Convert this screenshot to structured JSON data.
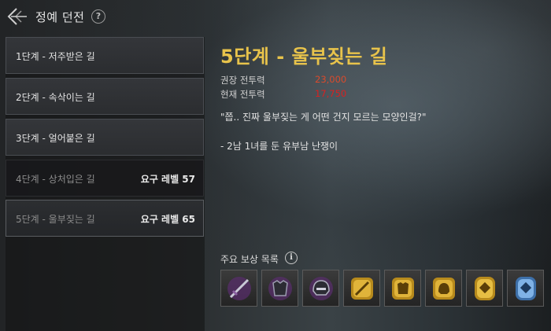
{
  "header": {
    "title": "정예 던전"
  },
  "stages": [
    {
      "label": "1단계 - 저주받은 길",
      "requirement": "",
      "state": "unlocked"
    },
    {
      "label": "2단계 - 속삭이는 길",
      "requirement": "",
      "state": "unlocked"
    },
    {
      "label": "3단계 - 얼어붙은 길",
      "requirement": "",
      "state": "unlocked"
    },
    {
      "label": "4단계 - 상처입은 길",
      "requirement": "요구 레벨 57",
      "state": "locked"
    },
    {
      "label": "5단계 - 울부짖는 길",
      "requirement": "요구 레벨 65",
      "state": "selected"
    }
  ],
  "detail": {
    "title": "5단계 - 울부짖는 길",
    "recommended_power_label": "권장 전투력",
    "recommended_power_value": "23,000",
    "current_power_label": "현재 전투력",
    "current_power_value": "17,750",
    "quote": "\"쯥.. 진짜 울부짖는 게 어떤 건지 모르는 모양인걸?\"",
    "description": "- 2남 1녀를 둔 유부남 난쟁이"
  },
  "rewards": {
    "title": "주요 보상 목록",
    "items": [
      {
        "icon": "purple-sword-icon"
      },
      {
        "icon": "purple-armor-icon"
      },
      {
        "icon": "purple-helmet-icon"
      },
      {
        "icon": "gold-sword-icon"
      },
      {
        "icon": "gold-armor-icon"
      },
      {
        "icon": "gold-helmet-icon"
      },
      {
        "icon": "gold-rune-icon"
      },
      {
        "icon": "blue-rune-icon"
      }
    ]
  },
  "colors": {
    "title_gold": "#e8c34b",
    "recommended_power": "#d94a2c",
    "current_power": "#d92020"
  }
}
